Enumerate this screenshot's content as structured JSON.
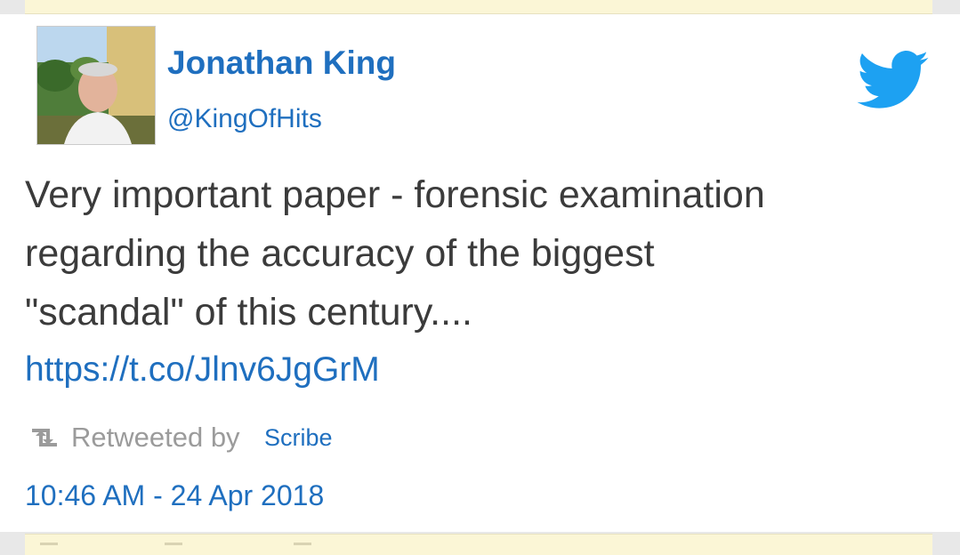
{
  "tweet": {
    "author_name": "Jonathan King",
    "author_handle": "@KingOfHits",
    "text_line1": "Very important paper - forensic examination",
    "text_line2": "regarding the accuracy of the biggest",
    "text_line3": "\"scandal\" of this century....",
    "link": "https://t.co/Jlnv6JgGrM",
    "retweeted_label": "Retweeted by",
    "retweeted_by": "Scribe",
    "timestamp": "10:46 AM - 24 Apr 2018"
  },
  "icons": {
    "logo": "twitter-bird-icon",
    "retweet": "retweet-icon",
    "avatar": "avatar-photo"
  },
  "colors": {
    "accent": "#1f6fbf",
    "twitter_blue": "#1da1f2",
    "text": "#3b3b3b",
    "muted": "#9b9b9b",
    "highlight_bar": "#fbf6d6"
  }
}
